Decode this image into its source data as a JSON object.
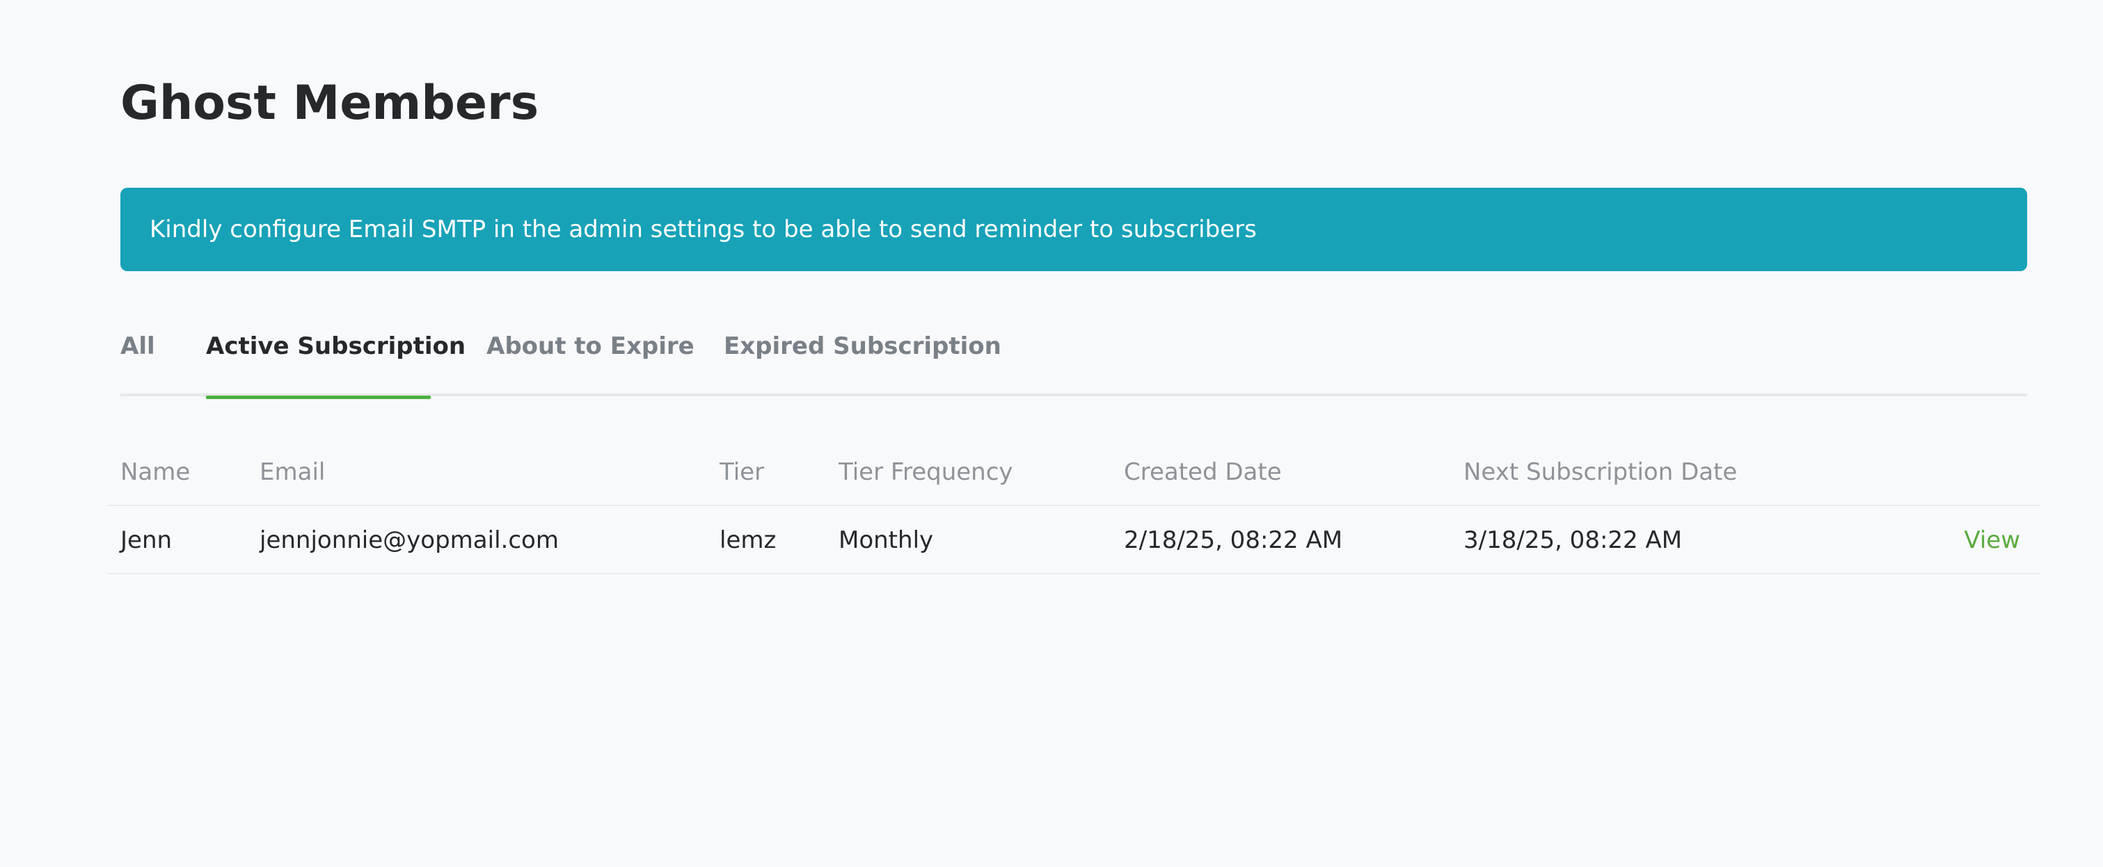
{
  "colors": {
    "alert_background": "#17a2b8",
    "accent_green": "#4caf3f",
    "view_link": "#5aab3f"
  },
  "page": {
    "title": "Ghost Members"
  },
  "alert": {
    "message": "Kindly configure Email SMTP in the admin settings to be able to send reminder to subscribers"
  },
  "tabs": [
    {
      "label": "All",
      "active": false
    },
    {
      "label": "Active Subscription",
      "active": true
    },
    {
      "label": "About to Expire",
      "active": false
    },
    {
      "label": "Expired Subscription",
      "active": false
    }
  ],
  "table": {
    "columns": [
      "Name",
      "Email",
      "Tier",
      "Tier Frequency",
      "Created Date",
      "Next Subscription Date"
    ],
    "rows": [
      {
        "name": "Jenn",
        "email": "jennjonnie@yopmail.com",
        "tier": "lemz",
        "frequency": "Monthly",
        "created": "2/18/25, 08:22 AM",
        "next": "3/18/25, 08:22 AM",
        "action": "View"
      }
    ]
  }
}
